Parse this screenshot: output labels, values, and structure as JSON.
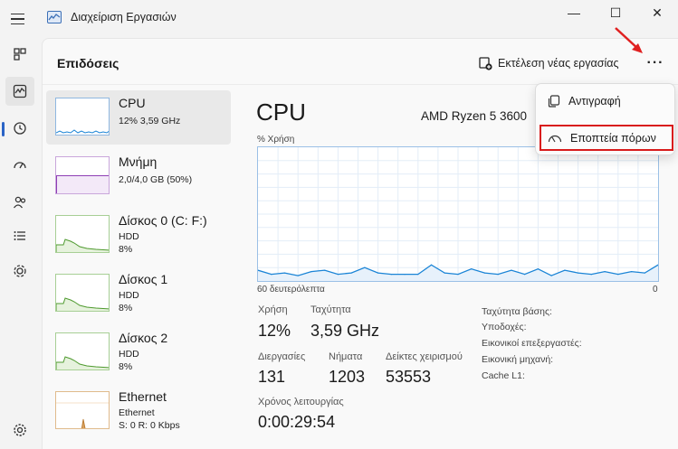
{
  "window": {
    "title": "Διαχείριση Εργασιών",
    "minimize_glyph": "—",
    "maximize_glyph": "☐",
    "close_glyph": "✕"
  },
  "nav": {
    "items": [
      "processes-icon",
      "performance-icon",
      "app-history-icon",
      "startup-apps-icon",
      "users-icon",
      "details-icon",
      "services-icon",
      "settings-icon"
    ],
    "active": "performance-icon"
  },
  "header": {
    "title": "Επιδόσεις",
    "run_task_label": "Εκτέλεση νέας εργασίας",
    "more_label": "···"
  },
  "perf_list": [
    {
      "name": "CPU",
      "line1": "12%  3,59 GHz",
      "line2": "",
      "line3": ""
    },
    {
      "name": "Μνήμη",
      "line1": "2,0/4,0 GB (50%)",
      "line2": "",
      "line3": ""
    },
    {
      "name": "Δίσκος 0 (C: F:)",
      "line1": "HDD",
      "line2": "8%",
      "line3": ""
    },
    {
      "name": "Δίσκος 1",
      "line1": "HDD",
      "line2": "8%",
      "line3": ""
    },
    {
      "name": "Δίσκος 2",
      "line1": "HDD",
      "line2": "8%",
      "line3": ""
    },
    {
      "name": "Ethernet",
      "line1": "Ethernet",
      "line2": "S: 0  R: 0 Kbps",
      "line3": ""
    }
  ],
  "detail": {
    "title": "CPU",
    "processor": "AMD Ryzen 5 3600",
    "graph_top_label": "% Χρήση",
    "graph_bottom_left": "60 δευτερόλεπτα",
    "graph_bottom_right": "0",
    "stats": {
      "usage_label": "Χρήση",
      "usage_value": "12%",
      "speed_label": "Ταχύτητα",
      "speed_value": "3,59 GHz",
      "processes_label": "Διεργασίες",
      "processes_value": "131",
      "threads_label": "Νήματα",
      "threads_value": "1203",
      "handles_label": "Δείκτες χειρισμού",
      "handles_value": "53553",
      "uptime_label": "Χρόνος λειτουργίας",
      "uptime_value": "0:00:29:54"
    },
    "side": {
      "base_speed": "Ταχύτητα βάσης:",
      "sockets": "Υποδοχές:",
      "virtual_processors": "Εικονικοί επεξεργαστές:",
      "virtual_machine": "Εικονική μηχανή:",
      "cache_l1": "Cache L1:"
    }
  },
  "menu": {
    "copy_label": "Αντιγραφή",
    "resource_monitor_label": "Εποπτεία πόρων"
  },
  "colors": {
    "accent": "#2a63c6",
    "cpu_graph": "#1a84d6",
    "memory_graph": "#8e3fb5",
    "disk_graph": "#4e9a2e",
    "ethernet_graph": "#b7762b",
    "highlight": "#d81b1b"
  },
  "chart_data": {
    "type": "line",
    "title": "",
    "xlabel": "60 δευτερόλεπτα",
    "ylabel": "% Χρήση",
    "ylim": [
      0,
      100
    ],
    "x": [
      60,
      58,
      56,
      54,
      52,
      50,
      48,
      46,
      44,
      42,
      40,
      38,
      36,
      34,
      32,
      30,
      28,
      26,
      24,
      22,
      20,
      18,
      16,
      14,
      12,
      10,
      8,
      6,
      4,
      2,
      0
    ],
    "series": [
      {
        "values": [
          8,
          5,
          6,
          4,
          7,
          8,
          5,
          6,
          10,
          6,
          5,
          5,
          5,
          12,
          6,
          5,
          9,
          6,
          5,
          8,
          5,
          9,
          4,
          8,
          6,
          5,
          7,
          5,
          7,
          6,
          12
        ]
      }
    ]
  }
}
